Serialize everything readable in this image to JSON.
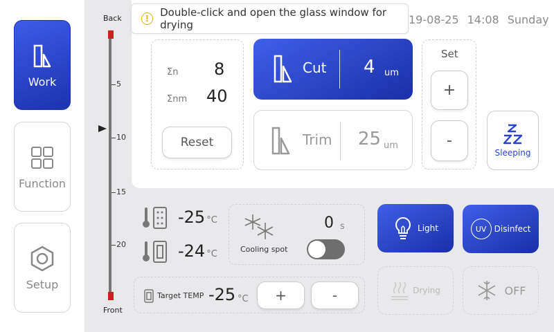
{
  "nav": {
    "work": "Work",
    "function": "Function",
    "setup": "Setup"
  },
  "ruler": {
    "top_label": "Back",
    "bottom_label": "Front",
    "ticks": [
      "5",
      "10",
      "15",
      "20"
    ]
  },
  "notice": {
    "message": "Double-click and open the glass window for drying"
  },
  "status": {
    "date": "19-08-25",
    "time": "14:08",
    "day": "Sunday"
  },
  "counter": {
    "sn_label": "Σn",
    "sn_value": "8",
    "snm_label": "Σnm",
    "snm_value": "40",
    "reset": "Reset"
  },
  "cut": {
    "label": "Cut",
    "value": "4",
    "unit": "um"
  },
  "trim": {
    "label": "Trim",
    "value": "25",
    "unit": "um"
  },
  "set": {
    "label": "Set",
    "plus": "+",
    "minus": "-"
  },
  "sleep": {
    "icon_text": "Z\nZZ",
    "label": "Sleeping"
  },
  "temps": {
    "chamber": {
      "value": "-25",
      "unit": "°C"
    },
    "specimen": {
      "value": "-24",
      "unit": "°C"
    }
  },
  "cooling": {
    "label": "Cooling spot",
    "value": "0",
    "unit": "s",
    "enabled": false
  },
  "target": {
    "label": "Target TEMP",
    "value": "-25",
    "unit": "°C",
    "plus": "+",
    "minus": "-"
  },
  "features": {
    "light": "Light",
    "uv_badge": "UV",
    "disinfect": "Disinfect",
    "drying": "Drying",
    "off": "OFF"
  },
  "colors": {
    "accent": "#2a44c8",
    "warning": "#e3b21c",
    "ruler_cap": "#cc1f1f"
  }
}
